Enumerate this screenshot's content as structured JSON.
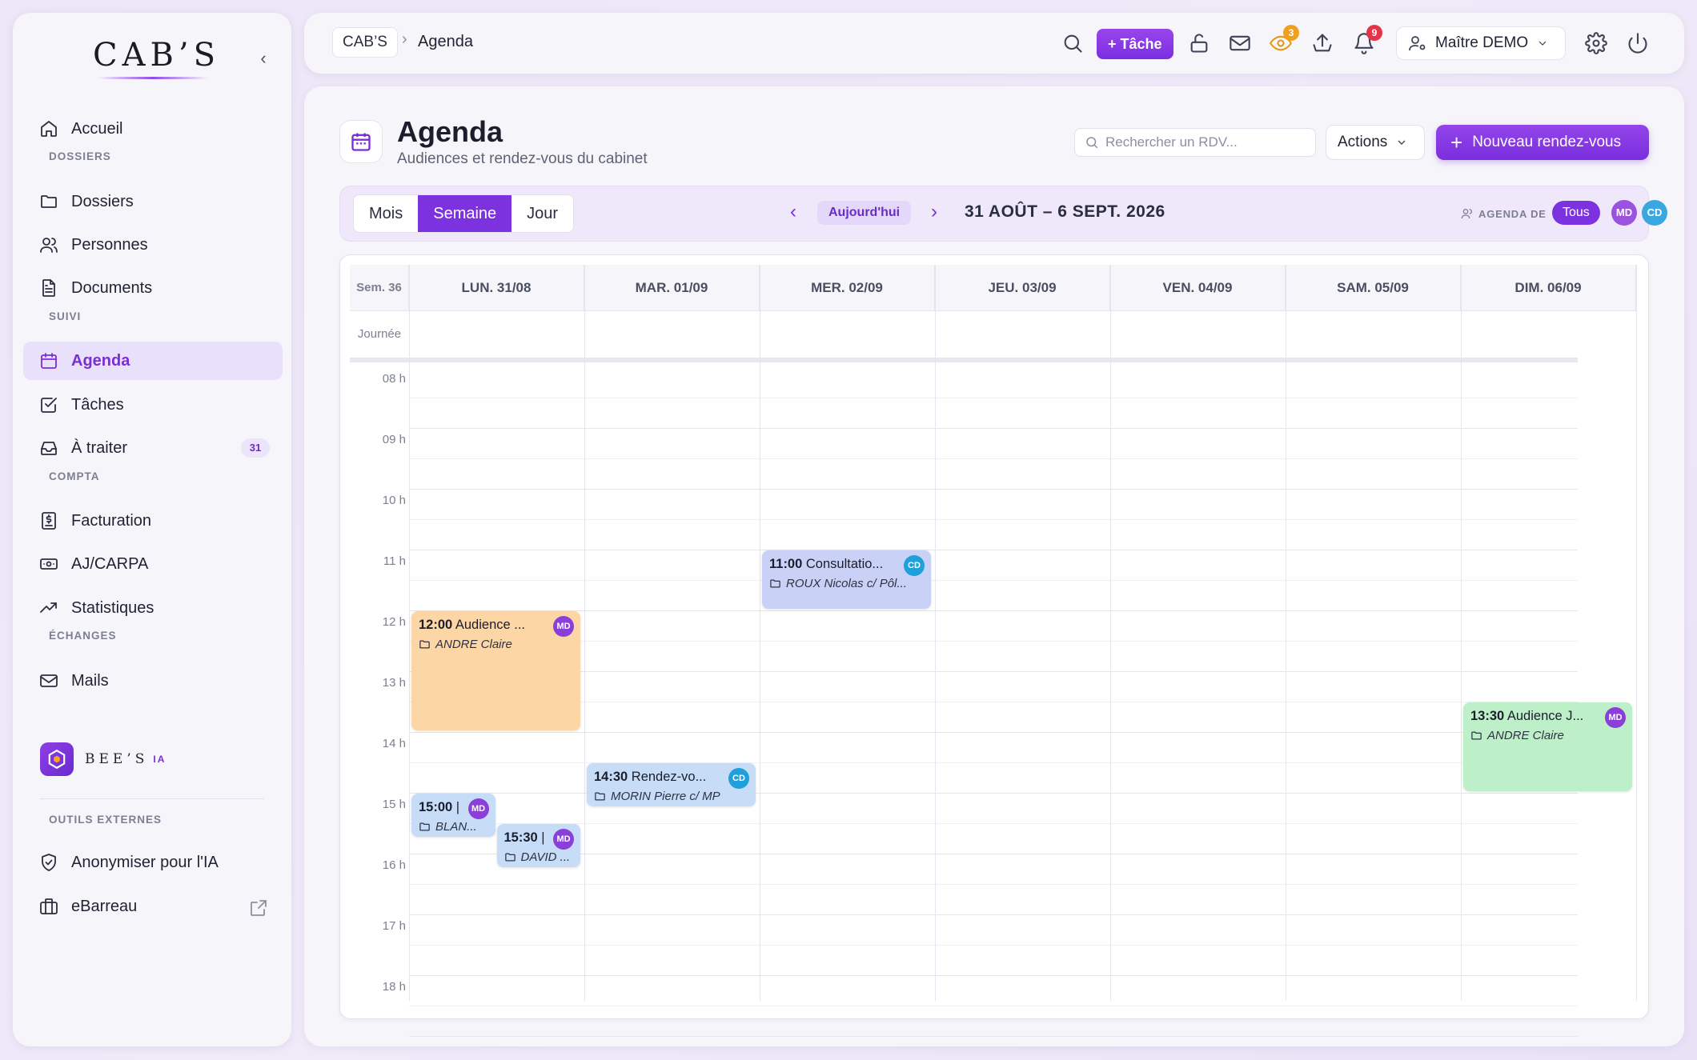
{
  "app": {
    "logo": "CAB’S",
    "bees_logo": "BEE’S",
    "bees_ia": "IA"
  },
  "sidebar": {
    "home": "Accueil",
    "sections": {
      "dossiers": "DOSSIERS",
      "suivi": "SUIVI",
      "compta": "COMPTA",
      "echanges": "ÉCHANGES",
      "outils": "OUTILS EXTERNES"
    },
    "items": {
      "dossiers": "Dossiers",
      "personnes": "Personnes",
      "documents": "Documents",
      "agenda": "Agenda",
      "taches": "Tâches",
      "a_traiter": "À traiter",
      "a_traiter_badge": "31",
      "facturation": "Facturation",
      "aj_carpa": "AJ/CARPA",
      "statistiques": "Statistiques",
      "mails": "Mails",
      "anonymiser": "Anonymiser pour l'IA",
      "ebarreau": "eBarreau"
    }
  },
  "topbar": {
    "breadcrumb_home": "CAB’S",
    "breadcrumb_sep": "›",
    "breadcrumb_current": "Agenda",
    "task_button": "+ Tâche",
    "eye_badge": "3",
    "bell_badge": "9",
    "user_name": "Maître DEMO"
  },
  "page": {
    "title": "Agenda",
    "subtitle": "Audiences et rendez-vous du cabinet",
    "search_placeholder": "Rechercher un RDV...",
    "actions_label": "Actions",
    "new_rdv_label": "Nouveau rendez-vous"
  },
  "toolbar": {
    "views": [
      "Mois",
      "Semaine",
      "Jour"
    ],
    "active_view": "Semaine",
    "prev": "‹",
    "next": "›",
    "today": "Aujourd'hui",
    "range": "31 AOÛT – 6 SEPT. 2026",
    "agenda_de": "AGENDA DE",
    "tous": "Tous",
    "avatars": [
      {
        "initials": "MD",
        "color": "#9b52e0"
      },
      {
        "initials": "CD",
        "color": "#38a8de"
      }
    ]
  },
  "calendar": {
    "week_label": "Sem. 36",
    "allday_label": "Journée",
    "days": [
      "LUN. 31/08",
      "MAR. 01/09",
      "MER. 02/09",
      "JEU. 03/09",
      "VEN. 04/09",
      "SAM. 05/09",
      "DIM. 06/09"
    ],
    "hours": [
      "08 h",
      "09 h",
      "10 h",
      "11 h",
      "12 h",
      "13 h",
      "14 h",
      "15 h",
      "16 h",
      "17 h",
      "18 h"
    ],
    "events": [
      {
        "day": 2,
        "start": 11.0,
        "end": 12.0,
        "time": "11:00",
        "title": "Consultatio...",
        "folder": "ROUX Nicolas c/ Pôl...",
        "avatar": "CD",
        "bg": "#c9d1f6",
        "avatar_color": "#1fa0db",
        "col": 0,
        "cols": 1
      },
      {
        "day": 0,
        "start": 12.0,
        "end": 14.0,
        "time": "12:00",
        "title": "Audience ...",
        "folder": "ANDRE Claire",
        "avatar": "MD",
        "bg": "#fdd6a6",
        "avatar_color": "#8a3fd8",
        "col": 0,
        "cols": 1
      },
      {
        "day": 6,
        "start": 13.5,
        "end": 15.0,
        "time": "13:30",
        "title": "Audience J...",
        "folder": "ANDRE Claire",
        "avatar": "MD",
        "bg": "#bdf0c9",
        "avatar_color": "#8a3fd8",
        "col": 0,
        "cols": 1
      },
      {
        "day": 1,
        "start": 14.5,
        "end": 15.25,
        "time": "14:30",
        "title": "Rendez-vo...",
        "folder": "MORIN Pierre c/ MP",
        "avatar": "CD",
        "bg": "#c6dcf7",
        "avatar_color": "#1fa0db",
        "col": 0,
        "cols": 1
      },
      {
        "day": 0,
        "start": 15.0,
        "end": 15.75,
        "time": "15:00",
        "title": "|",
        "folder": "BLAN...",
        "avatar": "MD",
        "bg": "#c6dcf7",
        "avatar_color": "#8a3fd8",
        "col": 0,
        "cols": 2
      },
      {
        "day": 0,
        "start": 15.5,
        "end": 16.25,
        "time": "15:30",
        "title": "|",
        "folder": "DAVID ...",
        "avatar": "MD",
        "bg": "#c6dcf7",
        "avatar_color": "#8a3fd8",
        "col": 1,
        "cols": 2
      }
    ]
  },
  "colors": {
    "accent": "#7d32e0",
    "eye_badge": "#f0a020",
    "bell_badge": "#e5344a"
  }
}
